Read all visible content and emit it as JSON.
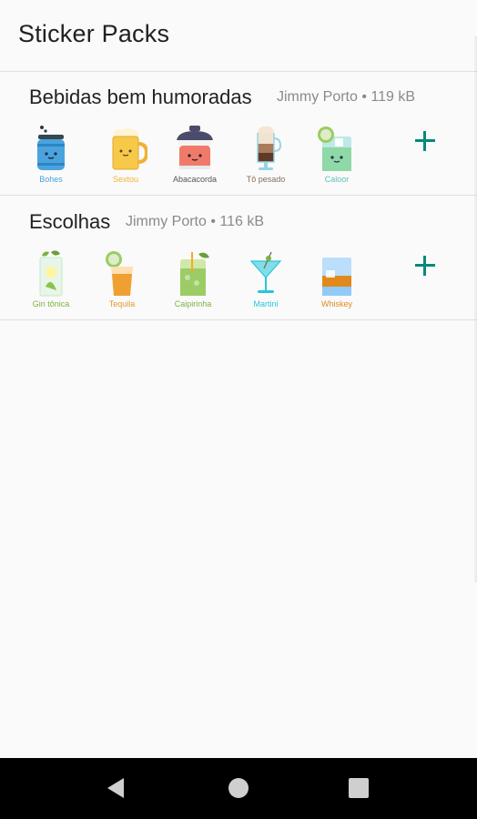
{
  "app": {
    "title": "Sticker Packs"
  },
  "packs": [
    {
      "name": "Bebidas bem humoradas",
      "publisher": "Jimmy Porto",
      "separator": "•",
      "size": "119 kB",
      "stickers": [
        {
          "label": "Bohes",
          "icon": "beer-can-icon",
          "color": "#4aa3df"
        },
        {
          "label": "Sextou",
          "icon": "beer-mug-icon",
          "color": "#f2b134"
        },
        {
          "label": "Abacacorda",
          "icon": "coffee-cup-icon",
          "color": "#555555"
        },
        {
          "label": "Tô pesado",
          "icon": "latte-glass-icon",
          "color": "#8a6d5a"
        },
        {
          "label": "Caloor",
          "icon": "lemon-drink-icon",
          "color": "#5bc0be"
        }
      ]
    },
    {
      "name": "Escolhas",
      "publisher": "Jimmy Porto",
      "separator": "•",
      "size": "116 kB",
      "stickers": [
        {
          "label": "Gin tônica",
          "icon": "gin-tonic-icon",
          "color": "#7cb342"
        },
        {
          "label": "Tequila",
          "icon": "tequila-shot-icon",
          "color": "#e39a2e"
        },
        {
          "label": "Caipirinha",
          "icon": "caipirinha-icon",
          "color": "#7cb342"
        },
        {
          "label": "Martini",
          "icon": "martini-glass-icon",
          "color": "#26c6da"
        },
        {
          "label": "Whiskey",
          "icon": "whiskey-glass-icon",
          "color": "#e08a1e"
        }
      ]
    }
  ],
  "navigation": {
    "back": "back-icon",
    "home": "home-icon",
    "recents": "recents-icon"
  }
}
